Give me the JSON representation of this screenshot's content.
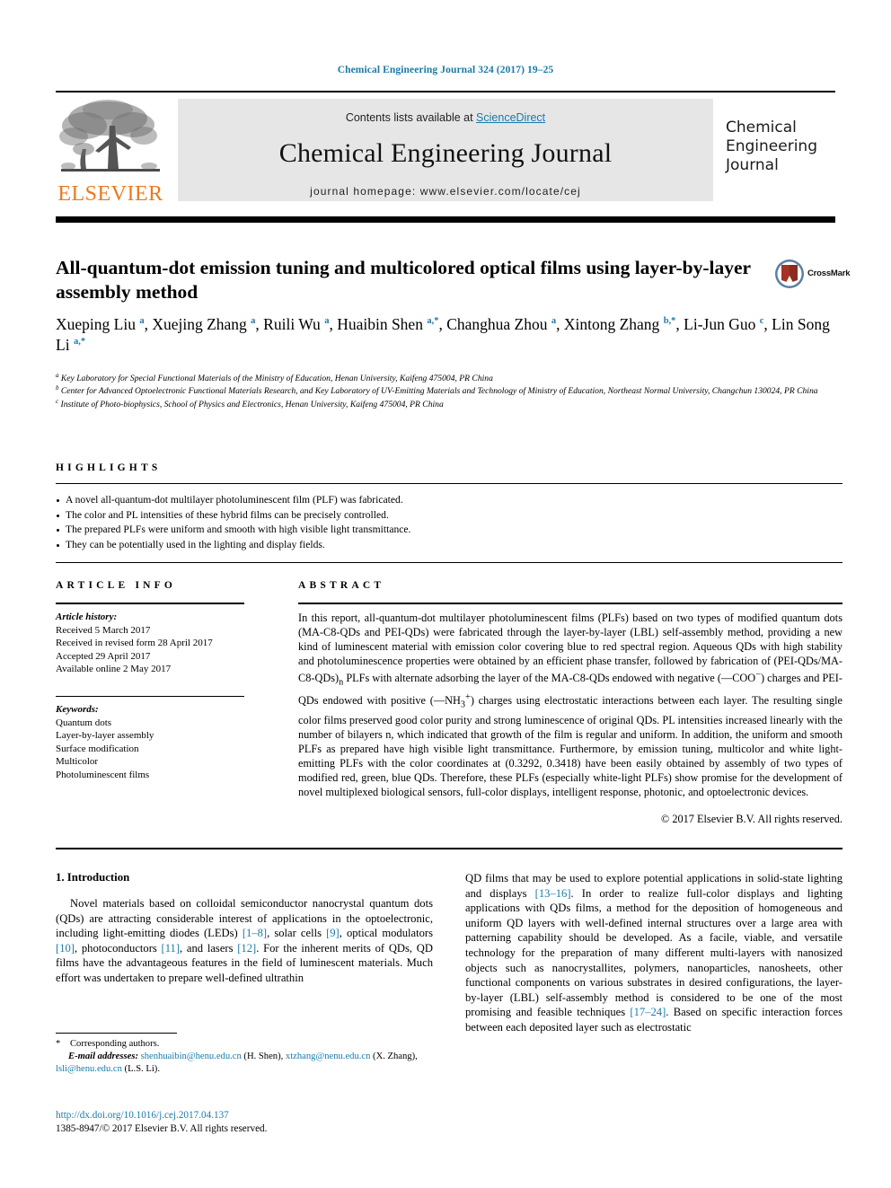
{
  "running_head": "Chemical Engineering Journal 324 (2017) 19–25",
  "header": {
    "contents_prefix": "Contents lists available at ",
    "sciencedirect": "ScienceDirect",
    "journal_name": "Chemical Engineering Journal",
    "homepage": "journal homepage: www.elsevier.com/locate/cej",
    "publisher_word": "ELSEVIER",
    "cover_line1": "Chemical",
    "cover_line2": "Engineering",
    "cover_line3": "Journal",
    "link_color": "#1a7aa8"
  },
  "article": {
    "title": "All-quantum-dot emission tuning and multicolored optical films using layer-by-layer assembly method",
    "crossmark_label": "CrossMark",
    "authors_html": "Xueping Liu <sup>a</sup>, Xuejing Zhang <sup>a</sup>, Ruili Wu <sup>a</sup>, Huaibin Shen <sup>a,*</sup>, Changhua Zhou <sup>a</sup>, Xintong Zhang <sup>b,*</sup>, Li-Jun Guo <sup>c</sup>, Lin Song Li <sup>a,*</sup>",
    "affiliations": [
      "<sup>a</sup> Key Laboratory for Special Functional Materials of the Ministry of Education, Henan University, Kaifeng 475004, PR China",
      "<sup>b</sup> Center for Advanced Optoelectronic Functional Materials Research, and Key Laboratory of UV-Emitting Materials and Technology of Ministry of Education, Northeast Normal University, Changchun 130024, PR China",
      "<sup>c</sup> Institute of Photo-biophysics, School of Physics and Electronics, Henan University, Kaifeng 475004, PR China"
    ]
  },
  "highlights": {
    "heading": "HIGHLIGHTS",
    "items": [
      "A novel all-quantum-dot multilayer photoluminescent film (PLF) was fabricated.",
      "The color and PL intensities of these hybrid films can be precisely controlled.",
      "The prepared PLFs were uniform and smooth with high visible light transmittance.",
      "They can be potentially used in the lighting and display fields."
    ]
  },
  "article_info": {
    "heading": "ARTICLE INFO",
    "history_label": "Article history:",
    "history": [
      "Received 5 March 2017",
      "Received in revised form 28 April 2017",
      "Accepted 29 April 2017",
      "Available online 2 May 2017"
    ],
    "keywords_label": "Keywords:",
    "keywords": [
      "Quantum dots",
      "Layer-by-layer assembly",
      "Surface modification",
      "Multicolor",
      "Photoluminescent films"
    ]
  },
  "abstract": {
    "heading": "ABSTRACT",
    "text_html": "In this report, all-quantum-dot multilayer photoluminescent films (PLFs) based on two types of modified quantum dots (MA-C8-QDs and PEI-QDs) were fabricated through the layer-by-layer (LBL) self-assembly method, providing a new kind of luminescent material with emission color covering blue to red spectral region. Aqueous QDs with high stability and photoluminescence properties were obtained by an efficient phase transfer, followed by fabrication of (PEI-QDs/MA-C8-QDs)<sub>n</sub> PLFs with alternate adsorbing the layer of the MA-C8-QDs endowed with negative (—COO<sup>−</sup>) charges and PEI-QDs endowed with positive (—NH<sub>3</sub><sup>+</sup>) charges using electrostatic interactions between each layer. The resulting single color films preserved good color purity and strong luminescence of original QDs. PL intensities increased linearly with the number of bilayers n, which indicated that growth of the film is regular and uniform. In addition, the uniform and smooth PLFs as prepared have high visible light transmittance. Furthermore, by emission tuning, multicolor and white light-emitting PLFs with the color coordinates at (0.3292, 0.3418) have been easily obtained by assembly of two types of modified red, green, blue QDs. Therefore, these PLFs (especially white-light PLFs) show promise for the development of novel multiplexed biological sensors, full-color displays, intelligent response, photonic, and optoelectronic devices.",
    "copyright": "© 2017 Elsevier B.V. All rights reserved."
  },
  "body": {
    "section_number_title": "1. Introduction",
    "left_paragraph_html": "Novel materials based on colloidal semiconductor nanocrystal quantum dots (QDs) are attracting considerable interest of applications in the optoelectronic, including light-emitting diodes (LEDs) <span class=\"ref\">[1–8]</span>, solar cells <span class=\"ref\">[9]</span>, optical modulators <span class=\"ref\">[10]</span>, photoconductors <span class=\"ref\">[11]</span>, and lasers <span class=\"ref\">[12]</span>. For the inherent merits of QDs, QD films have the advantageous features in the field of luminescent materials. Much effort was undertaken to prepare well-defined ultrathin",
    "right_paragraph_html": "QD films that may be used to explore potential applications in solid-state lighting and displays <span class=\"ref\">[13–16]</span>. In order to realize full-color displays and lighting applications with QDs films, a method for the deposition of homogeneous and uniform QD layers with well-defined internal structures over a large area with patterning capability should be developed. As a facile, viable, and versatile technology for the preparation of many different multi-layers with nanosized objects such as nanocrystallites, polymers, nanoparticles, nanosheets, other functional components on various substrates in desired configurations, the layer-by-layer (LBL) self-assembly method is considered to be one of the most promising and feasible techniques <span class=\"ref\">[17–24]</span>. Based on specific interaction forces between each deposited layer such as electrostatic"
  },
  "footnotes": {
    "corresponding": "Corresponding authors.",
    "email_line_html": "<span class=\"fn-ital\">E-mail addresses:</span> <span class=\"email\">shenhuaibin@henu.edu.cn</span> (H. Shen), <span class=\"email\">xtzhang@nenu.edu.cn</span> (X. Zhang), <span class=\"email\">lsli@henu.edu.cn</span> (L.S. Li).",
    "doi": "http://dx.doi.org/10.1016/j.cej.2017.04.137",
    "issn_line": "1385-8947/© 2017 Elsevier B.V. All rights reserved."
  }
}
